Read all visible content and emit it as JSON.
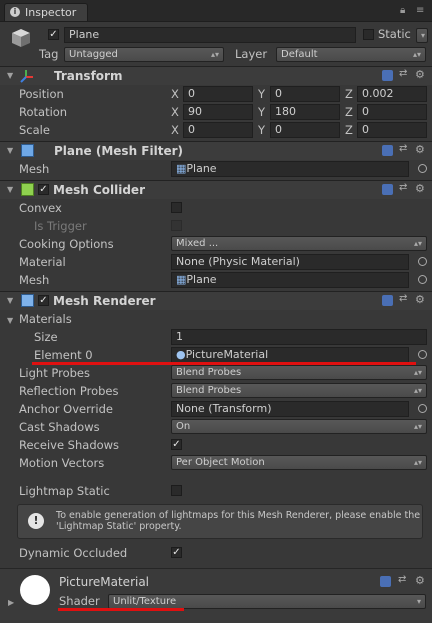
{
  "tab": {
    "label": "Inspector"
  },
  "object": {
    "name": "Plane",
    "static_label": "Static",
    "tag_label": "Tag",
    "tag_value": "Untagged",
    "layer_label": "Layer",
    "layer_value": "Default"
  },
  "transform": {
    "title": "Transform",
    "rows": [
      {
        "label": "Position",
        "x": "0",
        "y": "0",
        "z": "0.002"
      },
      {
        "label": "Rotation",
        "x": "90",
        "y": "180",
        "z": "0"
      },
      {
        "label": "Scale",
        "x": "0",
        "y": "0",
        "z": "0"
      }
    ],
    "axis": {
      "x": "X",
      "y": "Y",
      "z": "Z"
    }
  },
  "mesh_filter": {
    "title": "Plane (Mesh Filter)",
    "mesh_label": "Mesh",
    "mesh_value": "Plane"
  },
  "mesh_collider": {
    "title": "Mesh Collider",
    "convex_label": "Convex",
    "is_trigger_label": "Is Trigger",
    "cooking_label": "Cooking Options",
    "cooking_value": "Mixed ...",
    "material_label": "Material",
    "material_value": "None (Physic Material)",
    "mesh_label": "Mesh",
    "mesh_value": "Plane"
  },
  "mesh_renderer": {
    "title": "Mesh Renderer",
    "materials_label": "Materials",
    "size_label": "Size",
    "size_value": "1",
    "element0_label": "Element 0",
    "element0_value": "PictureMaterial",
    "light_probes_label": "Light Probes",
    "light_probes_value": "Blend Probes",
    "reflection_probes_label": "Reflection Probes",
    "reflection_probes_value": "Blend Probes",
    "anchor_label": "Anchor Override",
    "anchor_value": "None (Transform)",
    "cast_shadows_label": "Cast Shadows",
    "cast_shadows_value": "On",
    "receive_shadows_label": "Receive Shadows",
    "motion_vectors_label": "Motion Vectors",
    "motion_vectors_value": "Per Object Motion",
    "lightmap_static_label": "Lightmap Static",
    "help_text": "To enable generation of lightmaps for this Mesh Renderer, please enable the 'Lightmap Static' property.",
    "dynamic_occluded_label": "Dynamic Occluded"
  },
  "material": {
    "name": "PictureMaterial",
    "shader_label": "Shader",
    "shader_value": "Unlit/Texture"
  },
  "colors": {
    "background": "#383838",
    "field": "#2a2a2a",
    "annotation": "#e01010",
    "help_icon": "#e5e5e5"
  },
  "icons": [
    "inspector-info-icon",
    "lock-icon",
    "menu-icon",
    "cube-icon",
    "transform-axes-icon",
    "mesh-filter-icon",
    "mesh-collider-icon",
    "mesh-renderer-icon",
    "help-icon",
    "preset-icon",
    "gear-icon",
    "object-picker-icon",
    "info-icon",
    "material-sphere-icon"
  ]
}
